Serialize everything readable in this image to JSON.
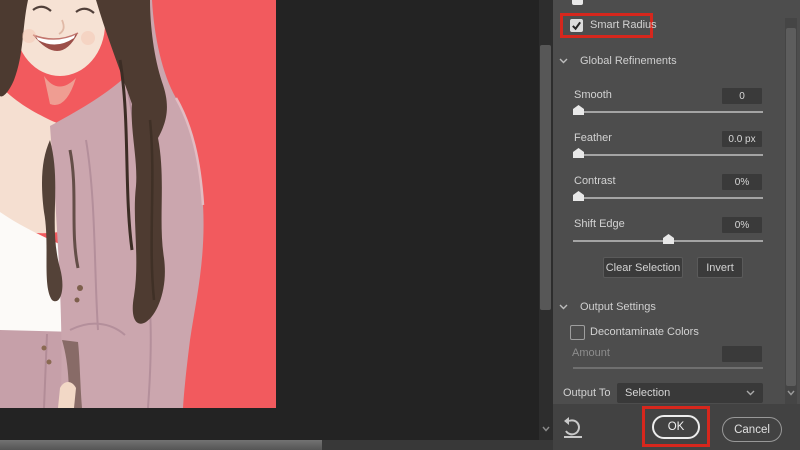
{
  "panel": {
    "smart_radius": {
      "label": "Smart Radius",
      "checked": true
    },
    "global_refinements": {
      "title": "Global Refinements",
      "sliders": [
        {
          "label": "Smooth",
          "value": "0"
        },
        {
          "label": "Feather",
          "value": "0.0 px"
        },
        {
          "label": "Contrast",
          "value": "0%"
        },
        {
          "label": "Shift Edge",
          "value": "0%"
        }
      ],
      "clear_selection_label": "Clear Selection",
      "invert_label": "Invert"
    },
    "output_settings": {
      "title": "Output Settings",
      "decontaminate_label": "Decontaminate Colors",
      "decontaminate_checked": false,
      "amount_label": "Amount",
      "amount_value": "",
      "output_to_label": "Output To",
      "output_to_value": "Selection"
    },
    "footer": {
      "ok_label": "OK",
      "cancel_label": "Cancel"
    }
  },
  "colors": {
    "highlight_red": "#d6271d",
    "panel_bg": "#4d4d4d",
    "canvas_bg": "#232323",
    "photo_background": "#f25a5e"
  },
  "icons": {
    "smart_radius": "check-icon",
    "sections": "chevron-down-icon",
    "output_to": "chevron-down-icon",
    "reset": "reset-arrow-icon",
    "scrollbars": "chevron-down-icon"
  }
}
